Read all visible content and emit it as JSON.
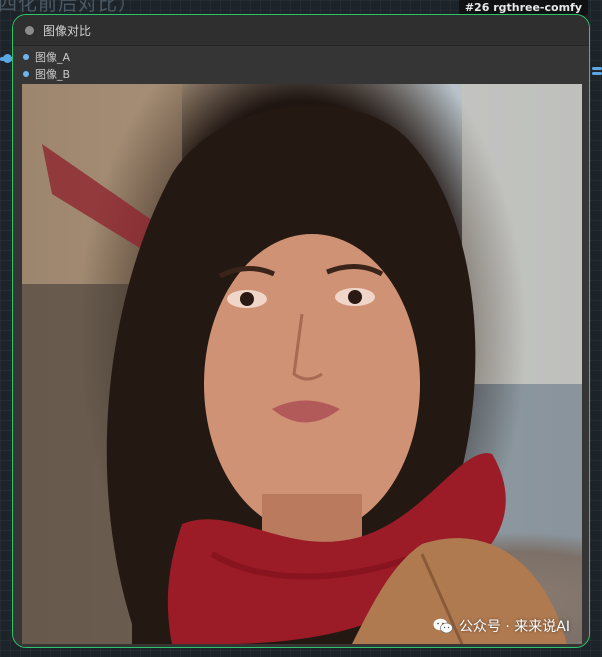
{
  "canvas": {
    "partial_title": "四化前后对比）"
  },
  "node": {
    "id_badge": "#26 rgthree-comfy",
    "title": "图像对比",
    "inputs": [
      {
        "label": "图像_A"
      },
      {
        "label": "图像_B"
      }
    ],
    "border_color": "#2ec46a",
    "slot_color": "#6db6ef"
  },
  "image": {
    "description_tag": "portrait-photo",
    "watermark": "公众号 · 来来说AI"
  }
}
